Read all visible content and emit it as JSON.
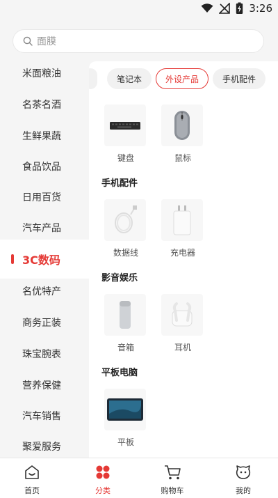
{
  "status_bar": {
    "time": "3:26"
  },
  "search": {
    "placeholder": "面膜"
  },
  "sidebar": {
    "items": [
      {
        "label": "米面粮油"
      },
      {
        "label": "名茶名酒"
      },
      {
        "label": "生鲜果蔬"
      },
      {
        "label": "食品饮品"
      },
      {
        "label": "日用百货"
      },
      {
        "label": "汽车产品"
      },
      {
        "label": "3C数码"
      },
      {
        "label": "名优特产"
      },
      {
        "label": "商务正装"
      },
      {
        "label": "珠宝腕表"
      },
      {
        "label": "营养保健"
      },
      {
        "label": "汽车销售"
      },
      {
        "label": "聚爱服务"
      }
    ],
    "active_index": 6
  },
  "tabs": [
    {
      "label": "笔记本"
    },
    {
      "label": "外设产品"
    },
    {
      "label": "手机配件"
    }
  ],
  "active_tab": 1,
  "sections": {
    "peripherals": {
      "items": [
        {
          "name": "键盘",
          "icon": "keyboard-icon"
        },
        {
          "name": "鼠标",
          "icon": "mouse-icon"
        }
      ]
    },
    "phone_accessories": {
      "title": "手机配件",
      "items": [
        {
          "name": "数据线",
          "icon": "cable-icon"
        },
        {
          "name": "充电器",
          "icon": "charger-icon"
        }
      ]
    },
    "audio_video": {
      "title": "影音娱乐",
      "items": [
        {
          "name": "音箱",
          "icon": "speaker-icon"
        },
        {
          "name": "耳机",
          "icon": "earbuds-icon"
        }
      ]
    },
    "tablets": {
      "title": "平板电脑",
      "items": [
        {
          "name": "平板",
          "icon": "tablet-icon"
        }
      ]
    }
  },
  "bottom_nav": {
    "items": [
      {
        "label": "首页",
        "icon": "home-icon"
      },
      {
        "label": "分类",
        "icon": "category-icon"
      },
      {
        "label": "购物车",
        "icon": "cart-icon"
      },
      {
        "label": "我的",
        "icon": "profile-icon"
      }
    ],
    "active_index": 1
  },
  "colors": {
    "accent": "#e53935",
    "background": "#f5f5f5"
  }
}
